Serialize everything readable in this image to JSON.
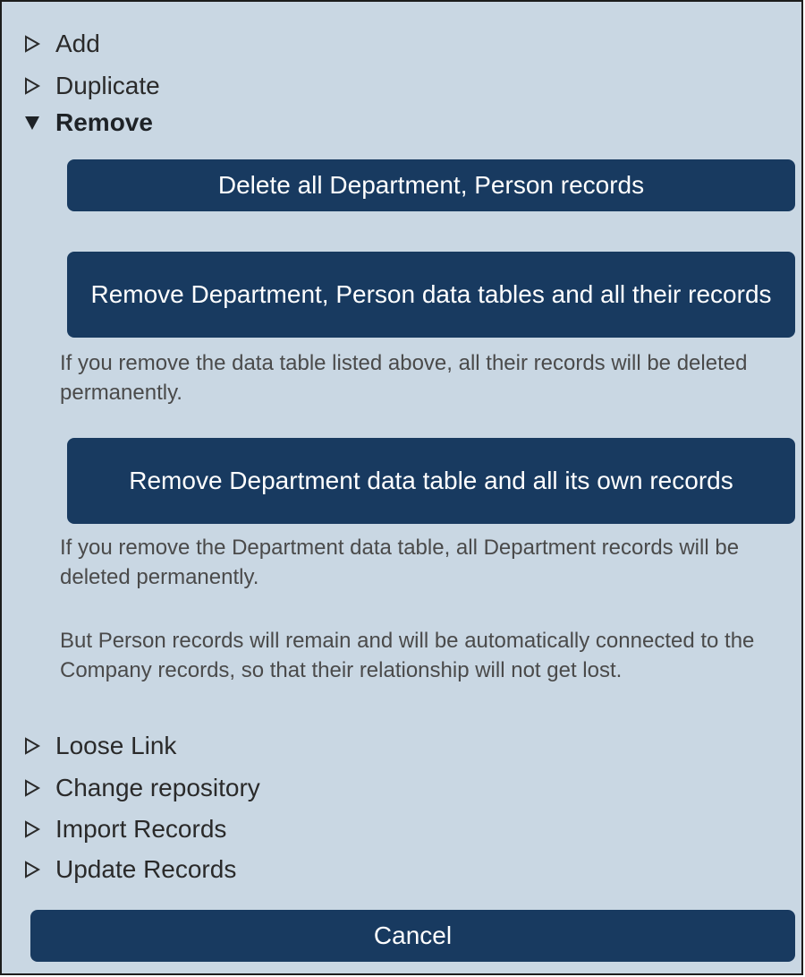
{
  "menu": {
    "add": {
      "label": "Add",
      "icon": "triangle-right-outline-icon"
    },
    "duplicate": {
      "label": "Duplicate",
      "icon": "triangle-right-outline-icon"
    },
    "remove": {
      "label": "Remove",
      "icon": "triangle-down-filled-icon"
    },
    "loose_link": {
      "label": "Loose Link",
      "icon": "triangle-right-outline-icon"
    },
    "change_repository": {
      "label": "Change repository",
      "icon": "triangle-right-outline-icon"
    },
    "import_records": {
      "label": "Import Records",
      "icon": "triangle-right-outline-icon"
    },
    "update_records": {
      "label": "Update Records",
      "icon": "triangle-right-outline-icon"
    }
  },
  "remove_section": {
    "delete_all_label": "Delete all Department, Person records",
    "remove_tables_label": "Remove Department, Person data tables and all their records",
    "remove_tables_note": "If you remove the data table listed above, all their records will be deleted permanently.",
    "remove_department_label": "Remove Department data table and all its own records",
    "remove_department_note_1": "If you remove the Department data table, all Department records will be deleted permanently.",
    "remove_department_note_2": "But Person records will remain and will be automatically connected to the Company records, so that their relationship will not get lost."
  },
  "footer": {
    "cancel_label": "Cancel"
  },
  "colors": {
    "panel_background": "#c9d7e3",
    "button_background": "#183a60",
    "button_text": "#ffffff",
    "note_text": "#4a4a4a"
  }
}
